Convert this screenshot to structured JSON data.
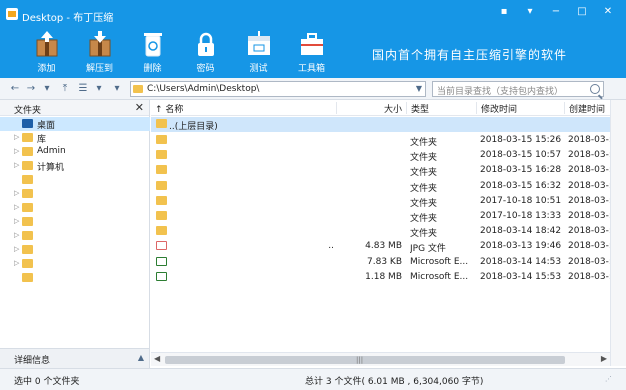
{
  "window": {
    "title": "Desktop - 布丁压缩"
  },
  "toolbar": {
    "tools": [
      {
        "label": "添加",
        "icon": "add-archive-icon"
      },
      {
        "label": "解压到",
        "icon": "extract-icon"
      },
      {
        "label": "删除",
        "icon": "delete-icon"
      },
      {
        "label": "密码",
        "icon": "lock-icon"
      },
      {
        "label": "测试",
        "icon": "test-icon"
      },
      {
        "label": "工具箱",
        "icon": "toolbox-icon"
      }
    ],
    "slogan": "国内首个拥有自主压缩引擎的软件"
  },
  "nav": {
    "path": "C:\\Users\\Admin\\Desktop\\",
    "search_placeholder": "当前目录查找（支持包内查找）"
  },
  "left_pane": {
    "header": "文件夹",
    "tree": [
      {
        "label": "桌面",
        "expandable": false,
        "selected": true
      },
      {
        "label": "库",
        "expandable": true
      },
      {
        "label": "Admin",
        "expandable": true
      },
      {
        "label": "计算机",
        "expandable": true
      },
      {
        "label": "",
        "expandable": false
      },
      {
        "label": "",
        "expandable": true
      },
      {
        "label": "",
        "expandable": true
      },
      {
        "label": "",
        "expandable": true
      },
      {
        "label": "",
        "expandable": true
      },
      {
        "label": "",
        "expandable": true
      },
      {
        "label": "",
        "expandable": true
      },
      {
        "label": "",
        "expandable": false
      }
    ],
    "footer": "详细信息"
  },
  "file_list": {
    "columns": [
      "名称",
      "大小",
      "类型",
      "修改时间",
      "创建时间"
    ],
    "parent_row": "..(上层目录)",
    "rows": [
      {
        "icon": "folder-icon",
        "name": "",
        "size": "",
        "type": "文件夹",
        "modified": "2018-03-15 15:26",
        "created": "2018-03-:"
      },
      {
        "icon": "folder-icon",
        "name": "",
        "size": "",
        "type": "文件夹",
        "modified": "2018-03-15 10:57",
        "created": "2018-03-:"
      },
      {
        "icon": "folder-icon",
        "name": "",
        "size": "",
        "type": "文件夹",
        "modified": "2018-03-15 16:28",
        "created": "2018-03-:"
      },
      {
        "icon": "folder-icon",
        "name": "",
        "size": "",
        "type": "文件夹",
        "modified": "2018-03-15 16:32",
        "created": "2018-03-:"
      },
      {
        "icon": "folder-icon",
        "name": "",
        "size": "",
        "type": "文件夹",
        "modified": "2017-10-18 10:51",
        "created": "2018-03-:"
      },
      {
        "icon": "folder-icon",
        "name": "",
        "size": "",
        "type": "文件夹",
        "modified": "2017-10-18 13:33",
        "created": "2018-03-:"
      },
      {
        "icon": "folder-icon",
        "name": "",
        "size": "",
        "type": "文件夹",
        "modified": "2018-03-14 18:42",
        "created": "2018-03-:"
      },
      {
        "icon": "jpg-file-icon",
        "name": "..",
        "size": "4.83 MB",
        "type": "JPG 文件",
        "modified": "2018-03-13 19:46",
        "created": "2018-03-:"
      },
      {
        "icon": "excel-file-icon",
        "name": "",
        "size": "7.83 KB",
        "type": "Microsoft E...",
        "modified": "2018-03-14 14:53",
        "created": "2018-03-:"
      },
      {
        "icon": "excel-file-icon",
        "name": "",
        "size": "1.18 MB",
        "type": "Microsoft E...",
        "modified": "2018-03-14 15:53",
        "created": "2018-03-:"
      }
    ]
  },
  "status": {
    "left": "选中 0 个文件夹",
    "center": "总计 3 个文件( 6.01 MB , 6,304,060 字节)"
  },
  "colors": {
    "accent": "#1696e6",
    "selection": "#cfe6fb"
  }
}
